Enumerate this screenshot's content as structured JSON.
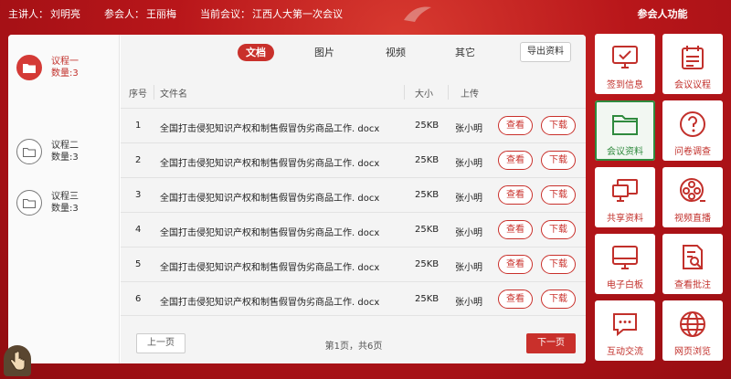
{
  "header": {
    "speaker_label": "主讲人：",
    "speaker": "刘明亮",
    "participant_label": "参会人：",
    "participant": "王丽梅",
    "meeting_label": "当前会议：",
    "meeting": "江西人大第一次会议",
    "side_title": "参会人功能"
  },
  "agenda": [
    {
      "title": "议程一",
      "count_label": "数量:3",
      "active": true
    },
    {
      "title": "议程二",
      "count_label": "数量:3",
      "active": false
    },
    {
      "title": "议程三",
      "count_label": "数量:3",
      "active": false
    }
  ],
  "tabs": [
    {
      "label": "文档",
      "active": true
    },
    {
      "label": "图片",
      "active": false
    },
    {
      "label": "视频",
      "active": false
    },
    {
      "label": "其它",
      "active": false
    }
  ],
  "export_label": "导出资料",
  "table": {
    "columns": {
      "no": "序号",
      "name": "文件名",
      "size": "大小",
      "uploader": "上传"
    },
    "rows": [
      {
        "no": "1",
        "name": "全国打击侵犯知识产权和制售假冒伪劣商品工作. docx",
        "size": "25KB",
        "uploader": "张小明"
      },
      {
        "no": "2",
        "name": "全国打击侵犯知识产权和制售假冒伪劣商品工作. docx",
        "size": "25KB",
        "uploader": "张小明"
      },
      {
        "no": "3",
        "name": "全国打击侵犯知识产权和制售假冒伪劣商品工作. docx",
        "size": "25KB",
        "uploader": "张小明"
      },
      {
        "no": "4",
        "name": "全国打击侵犯知识产权和制售假冒伪劣商品工作. docx",
        "size": "25KB",
        "uploader": "张小明"
      },
      {
        "no": "5",
        "name": "全国打击侵犯知识产权和制售假冒伪劣商品工作. docx",
        "size": "25KB",
        "uploader": "张小明"
      },
      {
        "no": "6",
        "name": "全国打击侵犯知识产权和制售假冒伪劣商品工作. docx",
        "size": "25KB",
        "uploader": "张小明"
      }
    ],
    "view_label": "查看",
    "download_label": "下载"
  },
  "pager": {
    "prev_label": "上一页",
    "info": "第1页，共6页",
    "next_label": "下一页"
  },
  "functions": [
    {
      "label": "签到信息",
      "icon": "monitor-check-icon",
      "active": false
    },
    {
      "label": "会议议程",
      "icon": "calendar-icon",
      "active": false
    },
    {
      "label": "会议资料",
      "icon": "folder-icon",
      "active": true
    },
    {
      "label": "问卷调查",
      "icon": "question-icon",
      "active": false
    },
    {
      "label": "共享资料",
      "icon": "shared-screens-icon",
      "active": false
    },
    {
      "label": "视频直播",
      "icon": "film-reel-icon",
      "active": false
    },
    {
      "label": "电子白板",
      "icon": "whiteboard-icon",
      "active": false
    },
    {
      "label": "查看批注",
      "icon": "document-search-icon",
      "active": false
    },
    {
      "label": "互动交流",
      "icon": "chat-icon",
      "active": false
    },
    {
      "label": "网页浏览",
      "icon": "globe-icon",
      "active": false
    }
  ],
  "colors": {
    "primary_red": "#c9302b",
    "active_green": "#2f8a3e"
  }
}
